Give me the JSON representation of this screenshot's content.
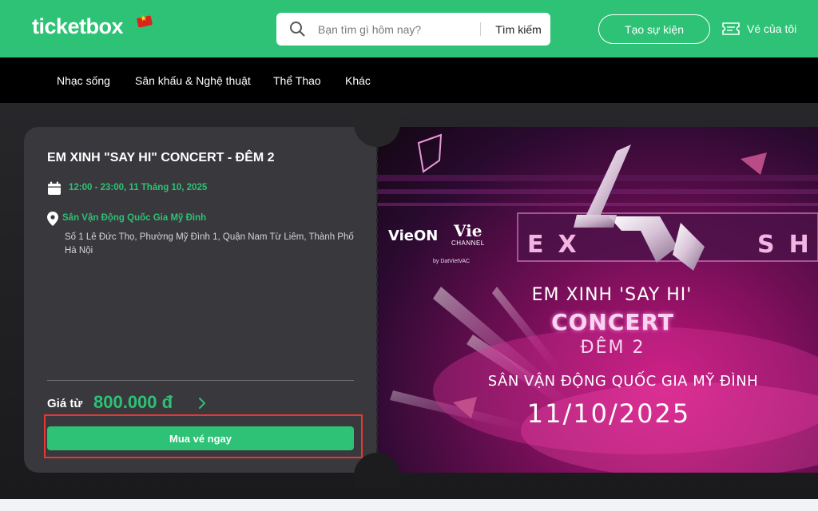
{
  "header": {
    "logo": "ticketbox",
    "search_placeholder": "Bạn tìm gì hôm nay?",
    "search_button": "Tìm kiếm",
    "create_event": "Tạo sự kiện",
    "my_tickets": "Vé của tôi"
  },
  "nav": {
    "items": [
      "Nhạc sống",
      "Sân khấu & Nghệ thuật",
      "Thể Thao",
      "Khác"
    ]
  },
  "event": {
    "title": "EM XINH \"SAY HI\" CONCERT - ĐÊM 2",
    "datetime": "12:00 - 23:00, 11 Tháng 10, 2025",
    "venue_name": "Sân Vận Động Quốc Gia Mỹ Đình",
    "venue_address": "Số 1 Lê Đức Thọ, Phường Mỹ Đình 1, Quận Nam Từ Liêm, Thành Phố Hà Nội",
    "price_label": "Giá từ",
    "price_value": "800.000 đ",
    "buy_button": "Mua vé ngay"
  },
  "banner": {
    "vieon": "VieON",
    "vie": "Vie",
    "channel": "CHANNEL",
    "byline": "by DatVietVAC",
    "logo_left": "EX",
    "logo_right": "SH",
    "line1": "EM XINH 'SAY HI'",
    "line2": "CONCERT",
    "line3": "ĐÊM 2",
    "line4": "SÂN VẬN ĐỘNG QUỐC GIA MỸ ĐÌNH",
    "line5": "11/10/2025"
  },
  "colors": {
    "brand_green": "#2dc275",
    "header_bg": "#2dc275",
    "nav_bg": "#000000",
    "card_bg": "#38383d",
    "highlight_red": "#e53935"
  },
  "icons": {
    "search": "search-icon",
    "ticket": "ticket-icon",
    "calendar": "calendar-icon",
    "location": "location-pin-icon",
    "chevron": "chevron-right-icon"
  }
}
